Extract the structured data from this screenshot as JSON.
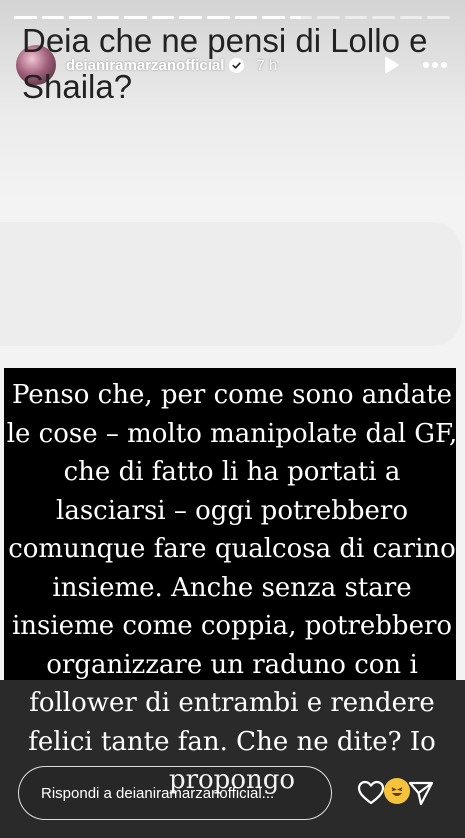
{
  "story": {
    "progress_segments": [
      {
        "fill": 1
      },
      {
        "fill": 1
      },
      {
        "fill": 1
      },
      {
        "fill": 1
      },
      {
        "fill": 1
      },
      {
        "fill": 1
      },
      {
        "fill": 1
      },
      {
        "fill": 1
      },
      {
        "fill": 1
      },
      {
        "fill": 1
      },
      {
        "fill": 0.5
      },
      {
        "fill": 0
      },
      {
        "fill": 0
      },
      {
        "fill": 0
      },
      {
        "fill": 0
      },
      {
        "fill": 0
      }
    ]
  },
  "header": {
    "username": "deianiramarzanofficial",
    "time": "7 h",
    "verified_icon": "verified-badge-icon",
    "play_icon": "play-icon",
    "more_icon": "more-icon"
  },
  "question": {
    "text": "Deia che ne pensi di Lollo e Shaila?"
  },
  "answer": {
    "text": "Penso che, per come sono andate le cose – molto manipolate dal GF, che di fatto li ha portati a lasciarsi – oggi potrebbero comunque fare qualcosa di carino insieme. Anche senza stare insieme come coppia, potrebbero organizzare un raduno con i follower di entrambi e rendere felici tante fan. Che ne dite? Io propongo"
  },
  "reply": {
    "placeholder": "Rispondi a deianiramarzanofficial..."
  },
  "colors": {
    "accent_emoji": "#f5c33b",
    "answer_bg": "#000000",
    "question_bg": "#ededed"
  }
}
